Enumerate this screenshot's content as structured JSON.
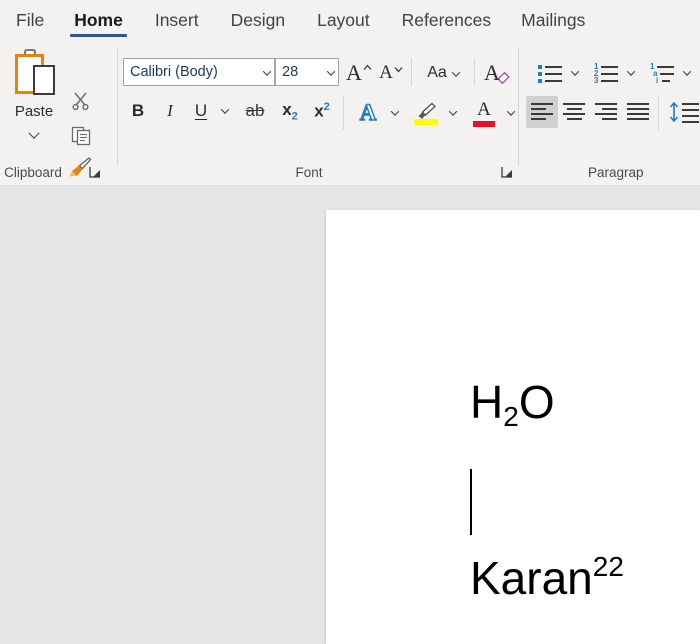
{
  "app": {
    "name": "Microsoft Word"
  },
  "ribbon": {
    "tabs": [
      {
        "label": "File",
        "active": false
      },
      {
        "label": "Home",
        "active": true
      },
      {
        "label": "Insert",
        "active": false
      },
      {
        "label": "Design",
        "active": false
      },
      {
        "label": "Layout",
        "active": false
      },
      {
        "label": "References",
        "active": false
      },
      {
        "label": "Mailings",
        "active": false
      }
    ],
    "active_tab": "Home",
    "accent_color": "#2b579a",
    "background_color": "#f3f2f1",
    "groups": {
      "clipboard": {
        "label": "Clipboard",
        "paste_label": "Paste",
        "paste_icon": "clipboard-icon",
        "paste_dropdown_icon": "chevron-down-icon",
        "cut_icon": "scissors-icon",
        "copy_icon": "copy-icon",
        "format_painter_icon": "paintbrush-icon",
        "dialog_launcher_icon": "dialog-launcher-icon"
      },
      "font": {
        "label": "Font",
        "font_name_value": "Calibri (Body)",
        "font_name_dropdown_icon": "chevron-down-icon",
        "font_size_value": "28",
        "font_size_dropdown_icon": "chevron-down-icon",
        "grow_font_label": "A",
        "grow_font_icon": "caret-up-icon",
        "shrink_font_label": "A",
        "shrink_font_icon": "caret-down-icon",
        "change_case_label": "Aa",
        "change_case_icon": "chevron-down-icon",
        "clear_formatting_label": "A",
        "clear_formatting_icon": "eraser-icon",
        "bold_label": "B",
        "italic_label": "I",
        "underline_label": "U",
        "underline_dropdown_icon": "chevron-down-icon",
        "strikethrough_label": "ab",
        "subscript_base": "x",
        "subscript_mark": "2",
        "superscript_base": "x",
        "superscript_mark": "2",
        "text_effects_label": "A",
        "text_effects_icon": "text-effects-icon",
        "text_effects_dropdown_icon": "chevron-down-icon",
        "highlight_icon": "highlighter-pen-icon",
        "highlight_color": "#ffff00",
        "highlight_dropdown_icon": "chevron-down-icon",
        "font_color_label": "A",
        "font_color": "#e81123",
        "font_color_dropdown_icon": "chevron-down-icon",
        "dialog_launcher_icon": "dialog-launcher-icon"
      },
      "paragraph": {
        "label": "Paragrap",
        "bullets_icon": "bullet-list-icon",
        "bullets_dropdown_icon": "chevron-down-icon",
        "numbering_icon": "numbered-list-icon",
        "numbering_marks": [
          "1",
          "2",
          "3"
        ],
        "numbering_dropdown_icon": "chevron-down-icon",
        "multilevel_icon": "multilevel-list-icon",
        "multilevel_marks": [
          "1",
          "a",
          "i"
        ],
        "multilevel_dropdown_icon": "chevron-down-icon",
        "align_left_icon": "align-left-icon",
        "align_center_icon": "align-center-icon",
        "align_right_icon": "align-right-icon",
        "justify_icon": "justify-icon",
        "line_spacing_icon": "line-spacing-icon",
        "selected_alignment": "align-left"
      }
    }
  },
  "document": {
    "background_color": "#e6e6e6",
    "page_color": "#ffffff",
    "lines": [
      {
        "id": "h2o",
        "base": "H",
        "sub_prefix": "2",
        "suffix": "O",
        "text": "H2O"
      },
      {
        "id": "karan",
        "base": "Karan",
        "sup": "22",
        "text": "Karan22"
      }
    ],
    "h2o_base": "H",
    "h2o_sub": "2",
    "h2o_tail": "O",
    "karan_base": "Karan",
    "karan_sup": "22",
    "caret_visible": true
  }
}
